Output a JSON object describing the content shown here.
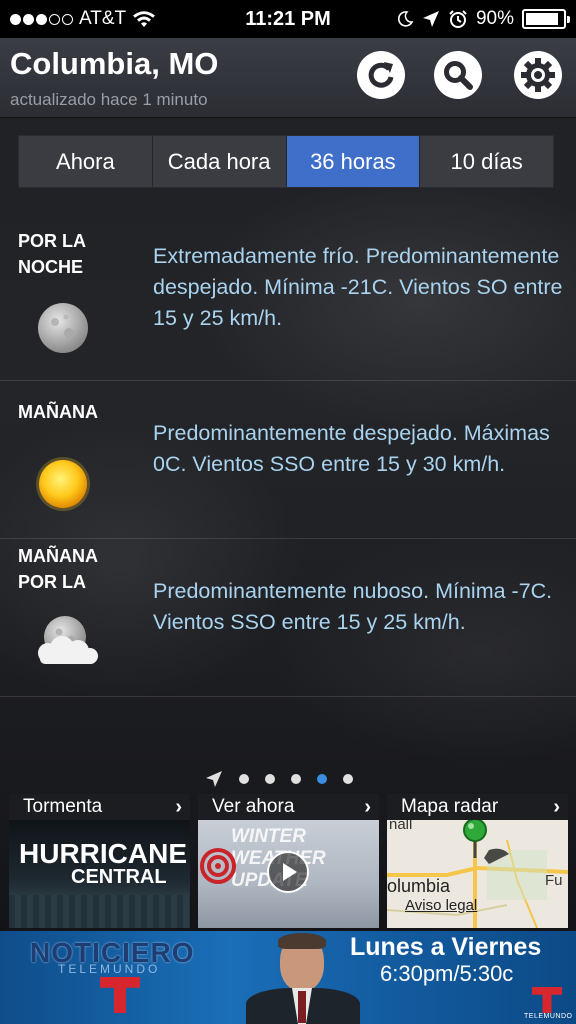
{
  "status_bar": {
    "carrier": "AT&T",
    "time": "11:21 PM",
    "battery": "90%",
    "battery_level": 0.9,
    "signal_bars": 3,
    "signal_total": 5
  },
  "header": {
    "city": "Columbia, MO",
    "updated": "actualizado hace 1 minuto"
  },
  "tabs": [
    {
      "label": "Ahora",
      "active": false
    },
    {
      "label": "Cada hora",
      "active": false
    },
    {
      "label": "36 horas",
      "active": true
    },
    {
      "label": "10 días",
      "active": false
    }
  ],
  "forecast": [
    {
      "period": "POR LA NOCHE",
      "text": "Extremadamente frío. Predominantemente despejado. Mínima -21C. Vientos SO entre 15 y 25 km/h.",
      "icon": "moon-icon"
    },
    {
      "period": "MAÑANA",
      "text": "Predominantemente despejado. Máximas 0C. Vientos SSO entre 15 y 30 km/h.",
      "icon": "sun-icon"
    },
    {
      "period": "MAÑANA POR LA",
      "text": "Predominantemente nuboso. Mínima -7C. Vientos SSO entre 15 y 25 km/h.",
      "icon": "moon-cloud-icon"
    }
  ],
  "pager": {
    "pages": 5,
    "active": 4
  },
  "tiles": [
    {
      "title": "Tormenta",
      "line1": "HURRICANE",
      "line2": "CENTRAL"
    },
    {
      "title": "Ver ahora",
      "line1": "WINTER",
      "line2": "WEATHER",
      "line3": "UPDATE"
    },
    {
      "title": "Mapa radar",
      "map_top": "nall",
      "map_city": "olumbia",
      "map_link": "Aviso legal",
      "map_right": "Fu"
    }
  ],
  "ad": {
    "brand": "NOTICIERO",
    "sub_brand": "TELEMUNDO",
    "days": "Lunes a Viernes",
    "times": "6:30pm/5:30c",
    "logo_letter": "T",
    "logo_text": "TELEMUNDO"
  },
  "colors": {
    "accent": "#3f6fc9",
    "forecast_text": "#a9d3ee"
  }
}
